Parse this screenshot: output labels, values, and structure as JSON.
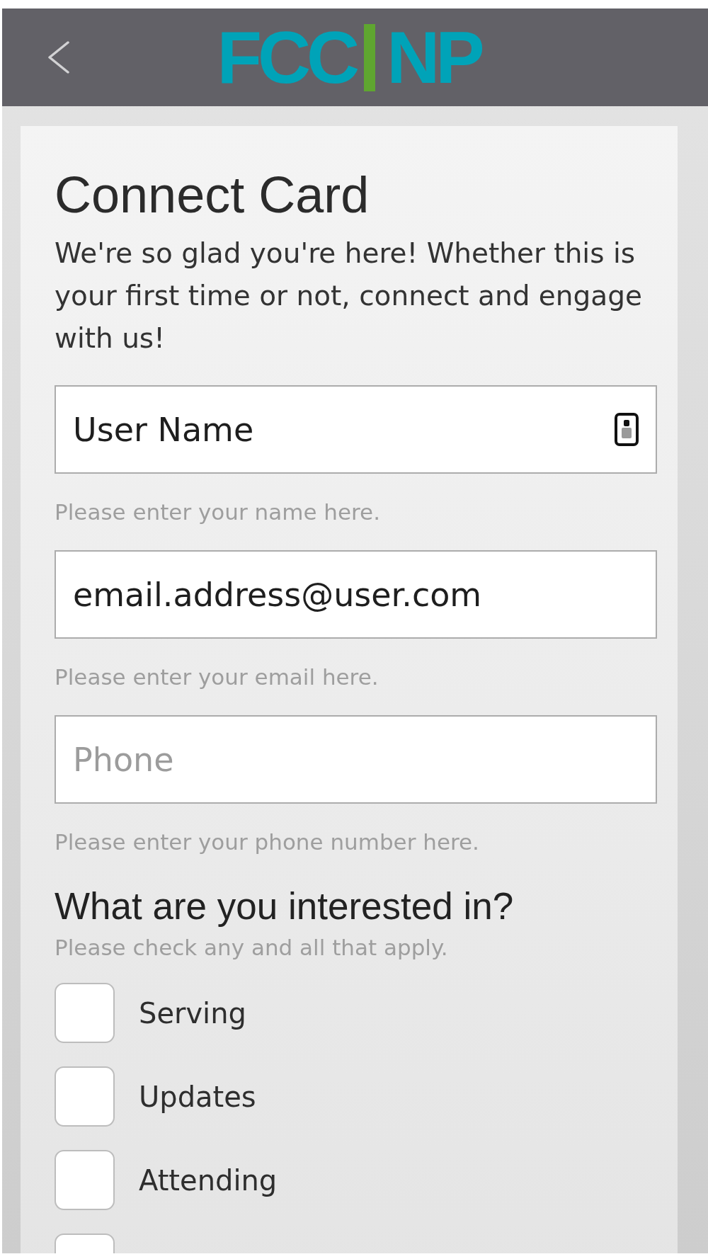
{
  "header": {
    "logo": [
      "FCC",
      "NP"
    ]
  },
  "card": {
    "title": "Connect Card",
    "intro": "We're so glad you're here! Whether this is your first time or not, connect and engage with us!",
    "fields": [
      {
        "kind": "icon",
        "value": "User Name",
        "hint": "Please enter your name here."
      },
      {
        "kind": "plain",
        "value": "email.address@user.com",
        "hint": "Please enter your email here."
      },
      {
        "kind": "plain",
        "placeholder": "Phone",
        "hint": "Please enter your phone number here."
      }
    ],
    "interests": {
      "heading": "What are you interested in?",
      "hint": "Please check any and all that apply.",
      "options": [
        {
          "label": "Serving",
          "checked": false
        },
        {
          "label": "Updates",
          "checked": false
        },
        {
          "label": "Attending",
          "checked": false
        },
        {
          "checked": false
        }
      ]
    }
  }
}
